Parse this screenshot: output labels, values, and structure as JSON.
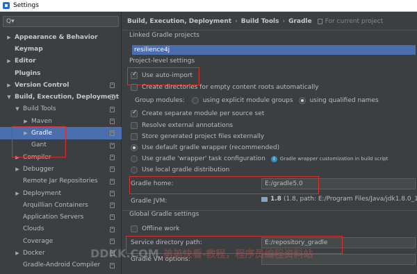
{
  "window": {
    "title": "Settings"
  },
  "search": {
    "placeholder": "Q▾"
  },
  "sidebar": {
    "items": [
      {
        "label": "Appearance & Behavior",
        "arrow": "▶",
        "bold": true,
        "indent": 8
      },
      {
        "label": "Keymap",
        "arrow": "",
        "bold": true,
        "indent": 8
      },
      {
        "label": "Editor",
        "arrow": "▶",
        "bold": true,
        "indent": 8
      },
      {
        "label": "Plugins",
        "arrow": "",
        "bold": true,
        "indent": 8
      },
      {
        "label": "Version Control",
        "arrow": "▶",
        "bold": true,
        "indent": 8
      },
      {
        "label": "Build, Execution, Deployment",
        "arrow": "▼",
        "bold": true,
        "indent": 8
      },
      {
        "label": "Build Tools",
        "arrow": "▼",
        "bold": false,
        "indent": 20
      },
      {
        "label": "Maven",
        "arrow": "▶",
        "bold": false,
        "indent": 32
      },
      {
        "label": "Gradle",
        "arrow": "▶",
        "bold": false,
        "indent": 32,
        "selected": true
      },
      {
        "label": "Gant",
        "arrow": "",
        "bold": false,
        "indent": 32
      },
      {
        "label": "Compiler",
        "arrow": "▶",
        "bold": false,
        "indent": 20
      },
      {
        "label": "Debugger",
        "arrow": "▶",
        "bold": false,
        "indent": 20
      },
      {
        "label": "Remote Jar Repositories",
        "arrow": "",
        "bold": false,
        "indent": 20
      },
      {
        "label": "Deployment",
        "arrow": "▶",
        "bold": false,
        "indent": 20
      },
      {
        "label": "Arquillian Containers",
        "arrow": "",
        "bold": false,
        "indent": 20
      },
      {
        "label": "Application Servers",
        "arrow": "",
        "bold": false,
        "indent": 20
      },
      {
        "label": "Clouds",
        "arrow": "",
        "bold": false,
        "indent": 20
      },
      {
        "label": "Coverage",
        "arrow": "",
        "bold": false,
        "indent": 20
      },
      {
        "label": "Docker",
        "arrow": "▶",
        "bold": false,
        "indent": 20
      },
      {
        "label": "Gradle-Android Compiler",
        "arrow": "",
        "bold": false,
        "indent": 20
      }
    ]
  },
  "breadcrumb": {
    "items": [
      "Build, Execution, Deployment",
      "Build Tools",
      "Gradle"
    ],
    "sep": "›",
    "for_current": "For current project"
  },
  "linked_projects": {
    "label": "Linked Gradle projects",
    "selected": "resilience4j"
  },
  "project_level": {
    "label": "Project-level settings",
    "use_auto_import": "Use auto-import",
    "create_dirs": "Create directories for empty content roots automatically",
    "group_modules": "Group modules:",
    "using_explicit": "using explicit module groups",
    "using_qualified": "using qualified names",
    "create_separate": "Create separate module per source set",
    "resolve_external": "Resolve external annotations",
    "store_generated": "Store generated project files externally",
    "use_default_wrapper": "Use default gradle wrapper (recommended)",
    "use_wrapper_task": "Use gradle 'wrapper' task configuration",
    "wrapper_note": "Gradle wrapper customization in build script",
    "use_local": "Use local gradle distribution",
    "gradle_home_label": "Gradle home:",
    "gradle_home_value": "E:/gradle5.0",
    "gradle_jvm_label": "Gradle JVM:",
    "gradle_jvm_ver": "1.8",
    "gradle_jvm_path": "(1.8, path: E:/Program Files/Java/jdk1.8.0_121)"
  },
  "global": {
    "label": "Global Gradle settings",
    "offline_work": "Offline work",
    "service_dir_label": "Service directory path:",
    "service_dir_value": "E:/repository_gradle",
    "vm_options_label": "Gradle VM options:",
    "vm_options_value": ""
  },
  "watermark": {
    "text": "DDKK.COM",
    "cn": "弟弟快看-教程，程序员编程资料站"
  },
  "colors": {
    "selection": "#4b6eaf",
    "annotation": "#d9302c",
    "background": "#3c3f41"
  }
}
